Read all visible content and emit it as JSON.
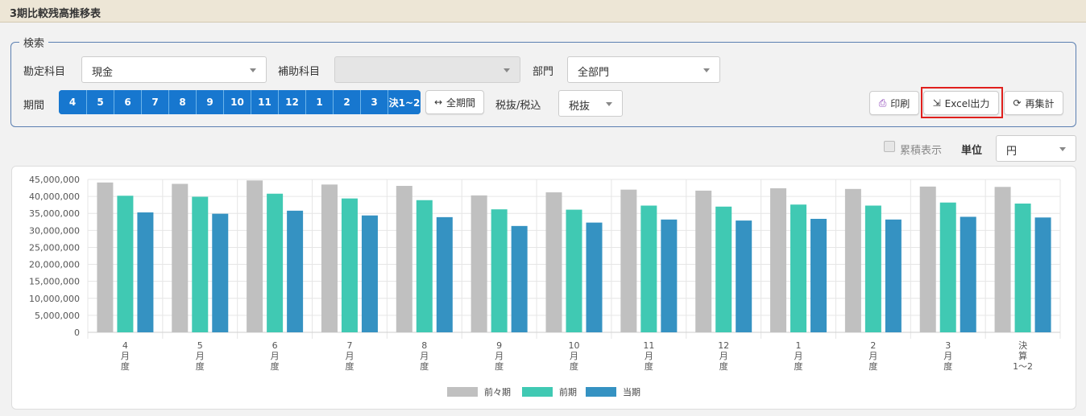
{
  "page": {
    "title": "3期比較残高推移表"
  },
  "search": {
    "legend": "検索",
    "account_label": "勘定科目",
    "account_value": "現金",
    "sub_account_label": "補助科目",
    "sub_account_value": "",
    "department_label": "部門",
    "department_value": "全部門",
    "period_label": "期間",
    "periods": [
      "4",
      "5",
      "6",
      "7",
      "8",
      "9",
      "10",
      "11",
      "12",
      "1",
      "2",
      "3",
      "決1~2"
    ],
    "all_periods_label": "全期間",
    "tax_label": "税抜/税込",
    "tax_value": "税抜"
  },
  "actions": {
    "print_label": "印刷",
    "excel_label": "Excel出力",
    "recalc_label": "再集計"
  },
  "options": {
    "cumulative_label": "累積表示",
    "unit_label": "単位",
    "unit_value": "円"
  },
  "colors": {
    "accent": "#1777cf",
    "highlight": "#e0201d",
    "series_prev2": "#c0c0c0",
    "series_prev": "#40c9b3",
    "series_current": "#3592c2"
  },
  "chart_data": {
    "type": "bar",
    "categories": [
      "4月度",
      "5月度",
      "6月度",
      "7月度",
      "8月度",
      "9月度",
      "10月度",
      "11月度",
      "12月度",
      "1月度",
      "2月度",
      "3月度",
      "決算1〜2"
    ],
    "category_label_lines": [
      [
        "4",
        "月",
        "度"
      ],
      [
        "5",
        "月",
        "度"
      ],
      [
        "6",
        "月",
        "度"
      ],
      [
        "7",
        "月",
        "度"
      ],
      [
        "8",
        "月",
        "度"
      ],
      [
        "9",
        "月",
        "度"
      ],
      [
        "10",
        "月",
        "度"
      ],
      [
        "11",
        "月",
        "度"
      ],
      [
        "12",
        "月",
        "度"
      ],
      [
        "1",
        "月",
        "度"
      ],
      [
        "2",
        "月",
        "度"
      ],
      [
        "3",
        "月",
        "度"
      ],
      [
        "決",
        "算",
        "1〜2"
      ]
    ],
    "series": [
      {
        "name": "前々期",
        "values": [
          44100000,
          43700000,
          44700000,
          43500000,
          43100000,
          40300000,
          41200000,
          42000000,
          41700000,
          42400000,
          42200000,
          42900000,
          42800000
        ]
      },
      {
        "name": "前期",
        "values": [
          40200000,
          39900000,
          40800000,
          39400000,
          38900000,
          36200000,
          36100000,
          37300000,
          37000000,
          37600000,
          37300000,
          38200000,
          37900000
        ]
      },
      {
        "name": "当期",
        "values": [
          35300000,
          34900000,
          35800000,
          34400000,
          33900000,
          31300000,
          32300000,
          33200000,
          32900000,
          33400000,
          33200000,
          34000000,
          33800000
        ]
      }
    ],
    "ylim": [
      0,
      45000000
    ],
    "yticks": [
      "0",
      "5,000,000",
      "10,000,000",
      "15,000,000",
      "20,000,000",
      "25,000,000",
      "30,000,000",
      "35,000,000",
      "40,000,000",
      "45,000,000"
    ],
    "ytick_values": [
      0,
      5000000,
      10000000,
      15000000,
      20000000,
      25000000,
      30000000,
      35000000,
      40000000,
      45000000
    ],
    "grid": true,
    "legend_position": "bottom"
  }
}
